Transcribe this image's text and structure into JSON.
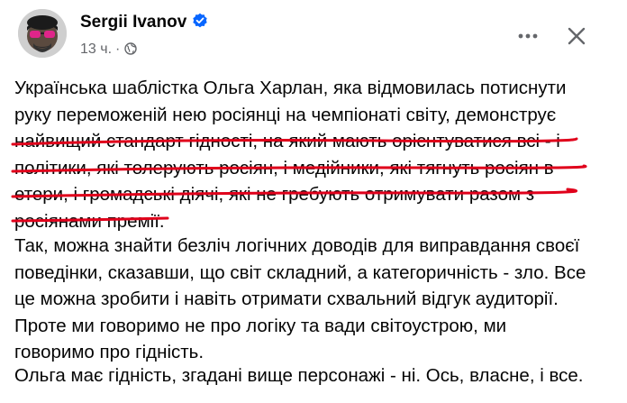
{
  "post": {
    "author": "Sergii Ivanov",
    "verified": true,
    "timestamp": "13 ч.",
    "dot": "·",
    "privacy_icon": "globe-icon",
    "actions": {
      "more_icon": "more-icon",
      "close_icon": "close-icon"
    },
    "paragraphs": [
      {
        "lines": [
          "Українська шаблістка Ольга Харлан, яка відмовилась потиснути",
          "руку переможеній нею росіянці на чемпіонаті світу, демонструє",
          "найвищий стандарт гідності, на який мають орієнтуватися всі - і",
          "політики, які толерують росіян, і медійники, які тягнуть росіян в",
          "етери, і громадські діячі, які не гребують отримувати разом з",
          "росіянами премії."
        ]
      },
      {
        "lines": [
          "Так, можна знайти безліч логічних доводів для виправдання своєї",
          "поведінки, сказавши, що світ складний, а категоричність - зло. Все",
          "це можна зробити і навіть отримати схвальний відгук аудиторії.",
          "Проте ми говоримо не про логіку та вади світоустрою, ми",
          "говоримо про гідність."
        ]
      },
      {
        "lines": [
          "Ольга має гідність, згадані вище персонажі - ні. Ось, власне, і все."
        ]
      }
    ],
    "colors": {
      "text": "#050505",
      "secondary": "#65676b",
      "verified_badge": "#0866ff",
      "annotation_underline": "#e0001b"
    }
  }
}
